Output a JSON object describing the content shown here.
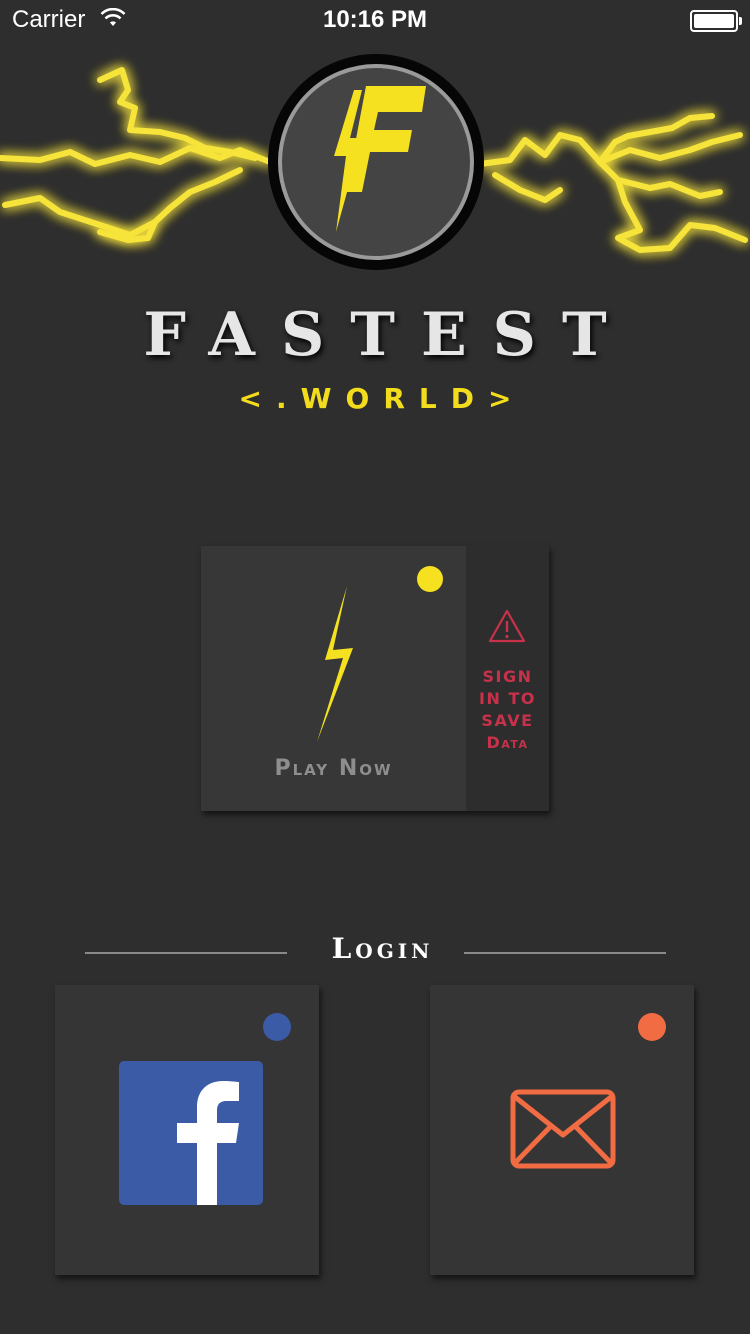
{
  "status_bar": {
    "carrier": "Carrier",
    "time": "10:16 PM"
  },
  "brand": {
    "title": "FASTEST",
    "subtitle": "<.WORLD>",
    "logo_letter": "F",
    "accent_color": "#f2dc1c"
  },
  "play": {
    "label": "Play Now",
    "sign_in_lines": [
      "SIGN",
      "IN TO",
      "SAVE",
      "Data"
    ],
    "warning_color": "#c8314a"
  },
  "login": {
    "label": "Login",
    "facebook": {
      "icon": "facebook-icon",
      "dot_color": "#3b5ba6"
    },
    "email": {
      "icon": "envelope-icon",
      "dot_color": "#f26c43"
    }
  }
}
